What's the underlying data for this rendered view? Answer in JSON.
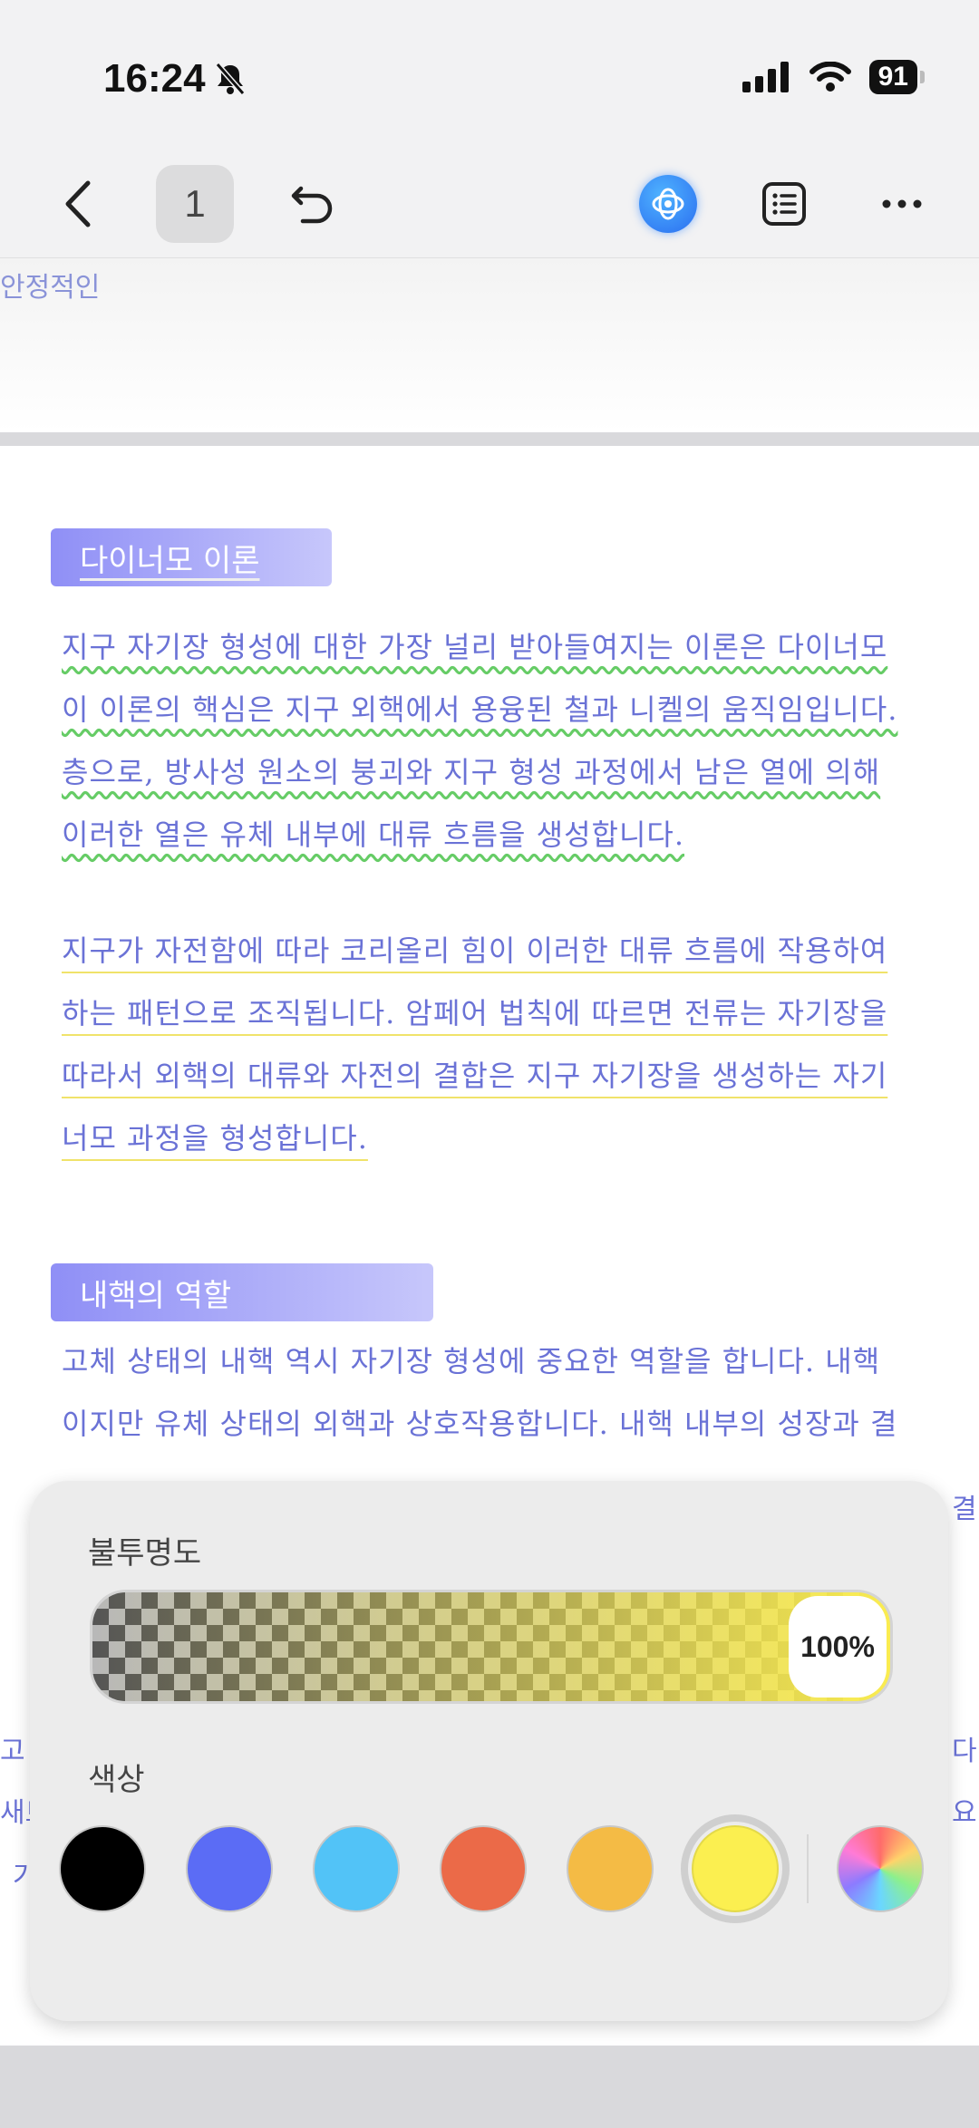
{
  "status_bar": {
    "time": "16:24",
    "battery": "91"
  },
  "toolbar": {
    "page_number": "1"
  },
  "previous_page": {
    "fragment": "안정적인"
  },
  "sections": [
    {
      "heading": "다이너모 이론",
      "paragraphs": [
        [
          "지구 자기장 형성에 대한 가장 널리 받아들여지는 이론은 다이너모",
          "이 이론의 핵심은 지구 외핵에서 용융된 철과 니켈의 움직임입니다.",
          "층으로, 방사성 원소의 붕괴와 지구 형성 과정에서 남은 열에 의해",
          "이러한 열은 유체 내부에 대류 흐름을 생성합니다."
        ],
        [
          "지구가 자전함에 따라 코리올리 힘이 이러한 대류 흐름에 작용하여",
          "하는 패턴으로 조직됩니다. 암페어 법칙에 따르면 전류는 자기장을",
          "따라서 외핵의 대류와 자전의 결합은 지구 자기장을 생성하는 자기",
          "너모 과정을 형성합니다."
        ]
      ]
    },
    {
      "heading": "내핵의 역할",
      "paragraphs": [
        [
          "고체 상태의 내핵 역시 자기장 형성에 중요한 역할을 합니다. 내핵",
          "이지만 유체 상태의 외핵과 상호작용합니다. 내핵 내부의 성장과 결"
        ]
      ]
    }
  ],
  "hidden_fragments": {
    "left": [
      "고",
      "새트",
      "가"
    ],
    "right": [
      "결",
      "다",
      "요"
    ]
  },
  "color_panel": {
    "opacity_label": "불투명도",
    "opacity_value": "100%",
    "color_label": "색상",
    "swatches": [
      {
        "name": "black",
        "color": "#000000"
      },
      {
        "name": "blue",
        "color": "#5b6cf5"
      },
      {
        "name": "sky-blue",
        "color": "#52c3f7"
      },
      {
        "name": "orange-red",
        "color": "#eb6a48"
      },
      {
        "name": "amber",
        "color": "#f4bb45"
      },
      {
        "name": "yellow",
        "color": "#fbef50",
        "selected": true
      }
    ]
  }
}
